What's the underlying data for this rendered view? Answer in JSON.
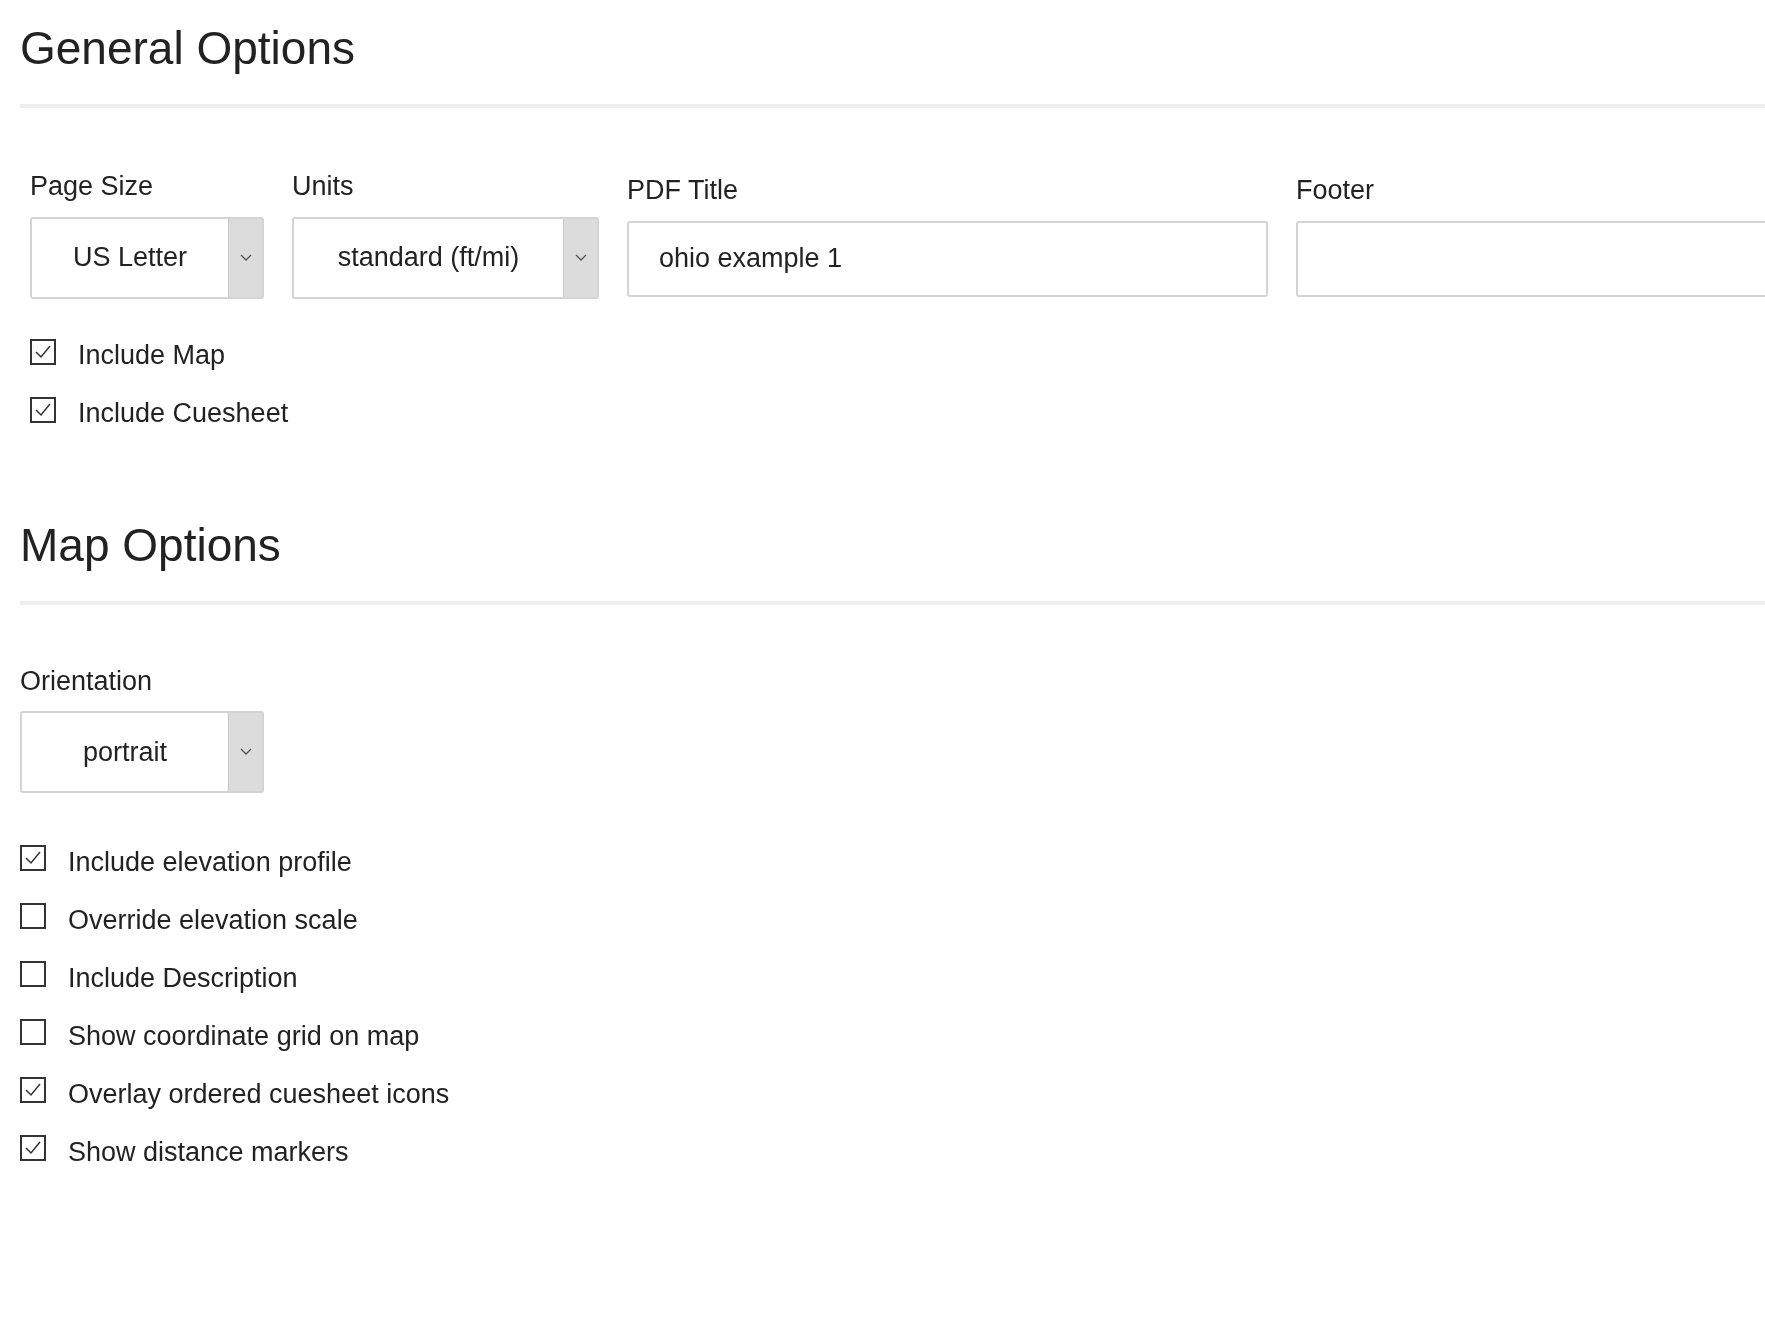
{
  "general": {
    "title": "General Options",
    "fields": [
      {
        "kind": "select",
        "label": "Page Size",
        "value": "US Letter"
      },
      {
        "kind": "select",
        "label": "Units",
        "value": "standard (ft/mi)"
      },
      {
        "kind": "text",
        "label": "PDF Title",
        "value": "ohio example 1"
      },
      {
        "kind": "text",
        "label": "Footer"
      }
    ],
    "checkboxes": [
      {
        "label": "Include Map",
        "checked": true
      },
      {
        "label": "Include Cuesheet",
        "checked": true
      }
    ]
  },
  "map": {
    "title": "Map Options",
    "orientation": {
      "label": "Orientation",
      "value": "portrait"
    },
    "checkboxes": [
      {
        "label": "Include elevation profile",
        "checked": true
      },
      {
        "label": "Override elevation scale",
        "checked": false
      },
      {
        "label": "Include Description",
        "checked": false
      },
      {
        "label": "Show coordinate grid on map",
        "checked": false
      },
      {
        "label": "Overlay ordered cuesheet icons",
        "checked": true
      },
      {
        "label": "Show distance markers",
        "checked": true
      }
    ]
  }
}
